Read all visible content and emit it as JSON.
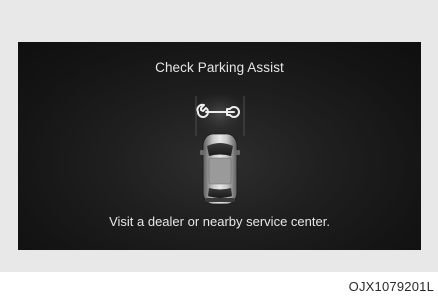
{
  "screen": {
    "title": "Check Parking Assist",
    "message": "Visit a dealer or nearby service center.",
    "icon": "wrench-icon"
  },
  "figure_code": "OJX1079201L"
}
